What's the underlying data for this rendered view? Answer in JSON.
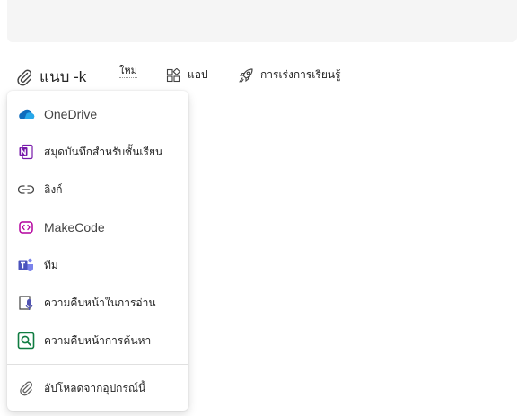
{
  "toolbar": {
    "attach_label": "แนบ -k",
    "new_label": "ใหม่",
    "apps_label": "แอป",
    "accelerator_label": "การเร่งการเรียนรู้"
  },
  "menu": {
    "items": [
      {
        "label": "OneDrive",
        "icon": "onedrive-icon"
      },
      {
        "label": "สมุดบันทึกสำหรับชั้นเรียน",
        "icon": "onenote-icon"
      },
      {
        "label": "ลิงก์",
        "icon": "link-icon"
      },
      {
        "label": "MakeCode",
        "icon": "makecode-icon"
      },
      {
        "label": "ทีม",
        "icon": "teams-icon"
      },
      {
        "label": "ความคืบหน้าในการอ่าน",
        "icon": "reading-progress-icon"
      },
      {
        "label": "ความคืบหน้าการค้นหา",
        "icon": "search-progress-icon"
      }
    ],
    "upload_label": "อัปโหลดจากอุปกรณ์นี้"
  },
  "colors": {
    "onedrive": "#0f6cbd",
    "onenote": "#7719aa",
    "makecode": "#b4009e",
    "teams": "#5b5fc7",
    "reading_progress": "#4f52b2",
    "search_progress": "#107c41"
  }
}
